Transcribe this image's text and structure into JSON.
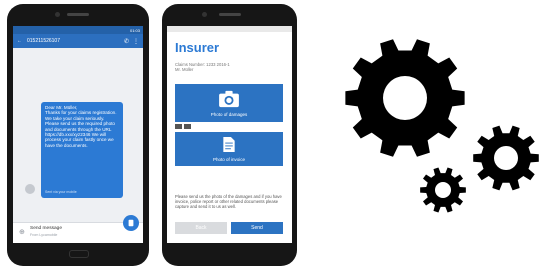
{
  "sms_phone": {
    "status_time": "01:03",
    "contact_number": "015211526107",
    "message_text": "Dear Mr. Müller,\nThanks for your claims registration. We take your claim seriously. Please send us the required photo and documents through the URL https://db.xxx/xyz2346 We will process your claim fastly once we have the documents.",
    "message_meta": "Sent via your mobile",
    "compose_placeholder": "Send message",
    "compose_sub": "From Lycamobile",
    "send_icon": "send-icon"
  },
  "insurer_phone": {
    "title": "Insurer",
    "claim_number": "Claims Number: 1233 2016-1",
    "claim_holder": "Mr. Müller",
    "tile_damages": "Photo of damages",
    "tile_invoice": "Photo of invoice",
    "note": "Please send us the photo of the damages and if you have invoice, police report or other related documents please capture and send it to us as well.",
    "back_label": "Back",
    "send_label": "Send"
  },
  "colors": {
    "accent_blue": "#2c73c2",
    "header_blue": "#2c6fbf",
    "gear_black": "#000000"
  },
  "icons": [
    "camera-icon",
    "document-icon",
    "gear-icon"
  ]
}
